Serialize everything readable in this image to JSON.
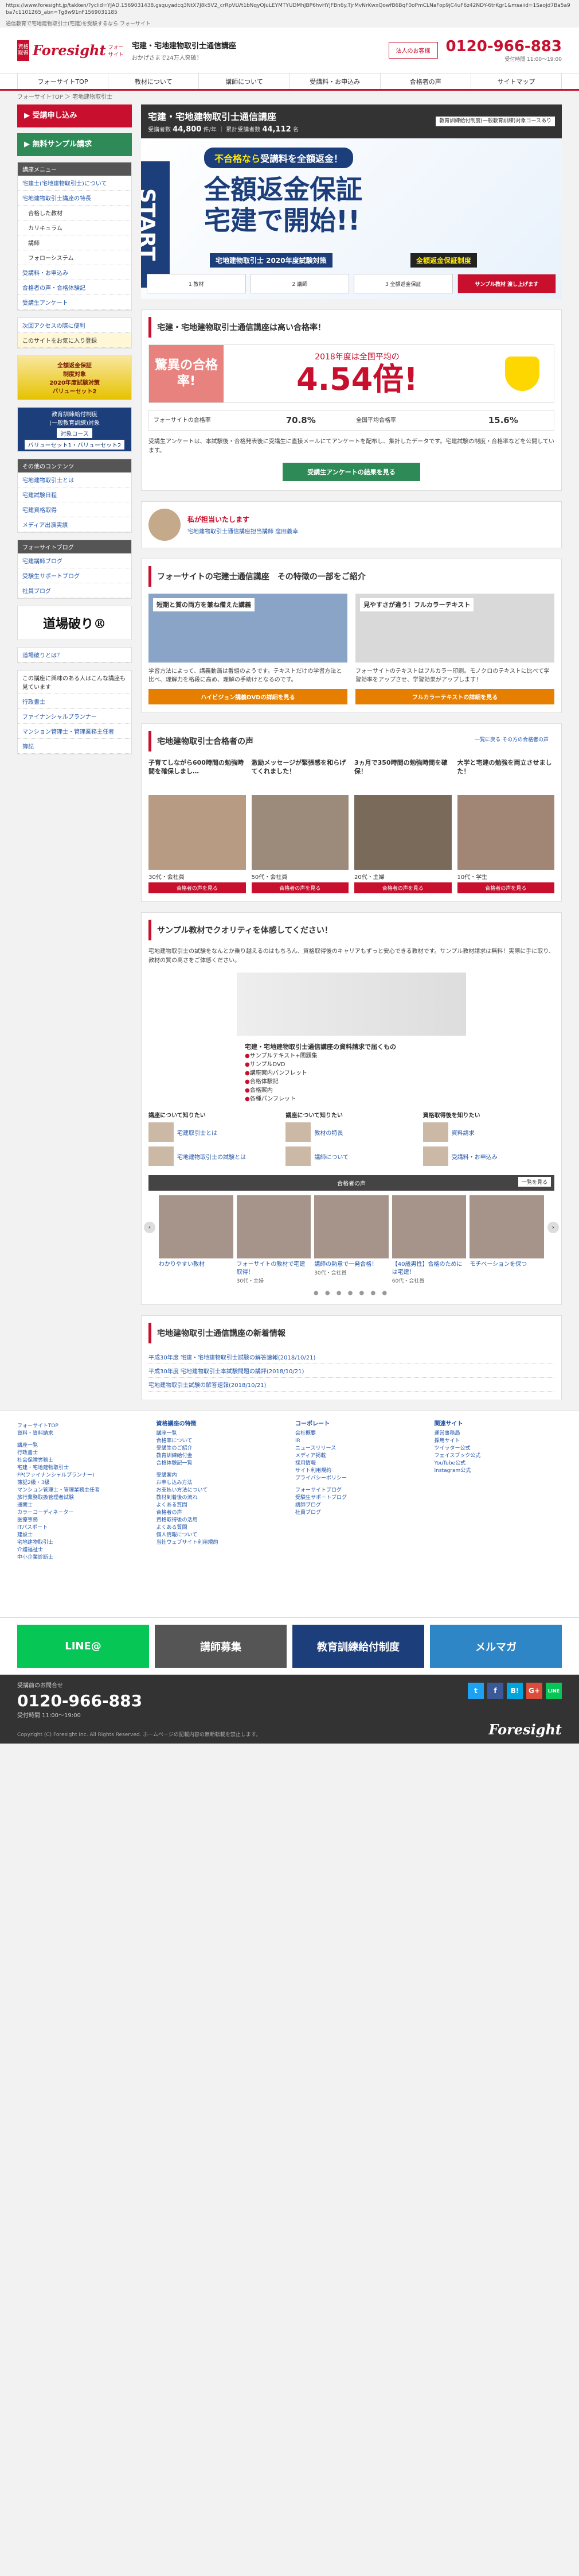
{
  "top": {
    "url": "https://www.foresight.jp/takken/?yclid=YJAD.1569031438.gsquyadcq3NtX7J8k5V2_crRpVLVt1bNqyOJuLEYMTYUDMhJBP6hvHYJFBn6y.TjrMvNrKwxQowfB6BqF0oPmCLNaFop9jC4uF6z42NDY-6trKgr1&msaiid=1SaoJd7Ba5a9ba7c1101265_abn=Tg8w91nF1569031185",
    "note": "通信教育で宅地建物取引士(宅建)を受験するなら フォーサイト"
  },
  "header": {
    "badge": "資格取得",
    "brand": "Foresight",
    "brand_sub": "フォーサイト",
    "title": "宅建・宅地建物取引士通信講座",
    "tagline": "おかげさまで24万人突破！",
    "corp_button": "法人のお客様",
    "tel": "0120-966-883",
    "tel_hours": "受付時間 11:00〜19:00"
  },
  "nav": [
    "フォーサイトTOP",
    "教材について",
    "講師について",
    "受講料・お申込み",
    "合格者の声",
    "サイトマップ"
  ],
  "breadcrumb": "フォーサイトTOP ＞ 宅地建物取引士",
  "sidebar": {
    "apply_button": "受講申し込み",
    "sample_button": "無料サンプル請求",
    "menu_title": "講座メニュー",
    "menu": [
      {
        "label": "宅建士(宅地建物取引士)について",
        "type": "main"
      },
      {
        "label": "宅地建物取引士講座の特長",
        "type": "main"
      },
      {
        "label": "合格した教材",
        "type": "sub"
      },
      {
        "label": "カリキュラム",
        "type": "sub"
      },
      {
        "label": "講師",
        "type": "sub"
      },
      {
        "label": "フォローシステム",
        "type": "sub"
      },
      {
        "label": "受講料・お申込み",
        "type": "main"
      },
      {
        "label": "合格者の声・合格体験記",
        "type": "main"
      },
      {
        "label": "受講生アンケート",
        "type": "main"
      }
    ],
    "guide_title": "次回アクセスの際に便利",
    "guide_item": "このサイトをお気に入り登録",
    "banner1": {
      "l1": "全額返金保証",
      "l2": "制度対象",
      "l3": "2020年度試験対策",
      "l4": "バリューセット2"
    },
    "banner2": {
      "l1": "教育訓練給付制度",
      "l2": "(一般教育訓練)対象",
      "l3": "対象コース",
      "l4": "バリューセット1・バリューセット2"
    },
    "other_title": "その他のコンテンツ",
    "other": [
      "宅地建物取引士とは",
      "宅建試験日程",
      "宅建資格取得",
      "メディア出演実績"
    ],
    "blog_title": "フォーサイトブログ",
    "blog": [
      "宅建講師ブログ",
      "受験生サポートブログ",
      "社員ブログ"
    ],
    "dojo": "道場破り®",
    "dojo_link": "道場破りとは？",
    "interest_title": "この講座に興味のある人はこんな講座も見ています",
    "interest": [
      "行政書士",
      "ファイナンシャルプランナー",
      "マンション管理士・管理業務主任者",
      "簿記"
    ]
  },
  "hero": {
    "title": "宅建・宅地建物取引士通信講座",
    "stats_label1": "受講者数",
    "stats_value1": "44,800",
    "stats_unit1": "件/年",
    "stats_label2": "累計受講者数",
    "stats_value2": "44,112",
    "stats_unit2": "名",
    "date_box": "教育訓練給付制度(一般教育訓練)対象コースあり",
    "start": "START",
    "ribbon_pre": "不合格なら",
    "ribbon_main": "受講料を全額返金！",
    "headline1": "全額返金保証",
    "headline2": "宅建で開始!!",
    "label1": "宅地建物取引士 2020年度試験対策",
    "label2": "全額返金保証制度",
    "thumbs": [
      "1 教材",
      "2 講師",
      "3 全額返金保証",
      "サンプル教材 渡し上げます"
    ]
  },
  "pass": {
    "title": "宅建・宅地建物取引士通信講座は高い合格率！",
    "left": "驚異の合格率!",
    "sub": "2018年度は全国平均の",
    "big": "4.54倍!",
    "fs_label": "フォーサイトの合格率",
    "fs_value": "70.8%",
    "nat_label": "全国平均合格率",
    "nat_value": "15.6%",
    "note": "受講生アンケートは、本試験後・合格発表後に受講生に直接メールにてアンケートを配布し、集計したデータです。宅建試験の制度・合格率などを公開しています。",
    "button": "受講生アンケートの結果を見る"
  },
  "teacher": {
    "title": "私が担当いたします",
    "name": "宅地建物取引士通信講座担当講師 窪田義幸"
  },
  "features": {
    "title": "フォーサイトの宅建士通信講座　その特徴の一部をご紹介",
    "cards": [
      {
        "cap": "短期と質の両方を兼ね備えた講義",
        "text": "学習方法によって、講義動画は番組のようです。テキストだけの学習方法と比べ、理解力を格段に高め、理解の手助けとなるのです。",
        "btn": "ハイビジョン講義DVDの詳細を見る"
      },
      {
        "cap": "見やすさが違う！フルカラーテキスト",
        "text": "フォーサイトのテキストはフルカラー印刷。モノクロのテキストに比べて学習効率をアップさせ、学習効果がアップします！",
        "btn": "フルカラーテキストの詳細を見る"
      }
    ]
  },
  "voices": {
    "title": "宅地建物取引士合格者の声",
    "link": "一覧に戻る その方の合格者の声",
    "items": [
      {
        "quote": "子育てしながら600時間の勉強時間を確保しまし…",
        "name": "30代・会社員",
        "btn": "合格者の声を見る"
      },
      {
        "quote": "激励メッセージが緊張感を和らげてくれました！",
        "name": "50代・会社員",
        "btn": "合格者の声を見る"
      },
      {
        "quote": "3ヵ月で350時間の勉強時間を確保！",
        "name": "20代・主婦",
        "btn": "合格者の声を見る"
      },
      {
        "quote": "大学と宅建の勉強を両立させました！",
        "name": "10代・学生",
        "btn": "合格者の声を見る"
      }
    ]
  },
  "sample": {
    "title": "サンプル教材でクオリティを体感してください！",
    "text": "宅地建物取引士の試験をなんとか乗り越えるのはもちろん、資格取得後のキャリアもずっと安心できる教材です。サンプル教材請求は無料！実際に手に取り、教材の質の高さをご体感ください。",
    "list_title": "宅建・宅地建物取引士通信講座の資料請求で届くもの",
    "list": [
      "サンプルテキスト+問題集",
      "サンプルDVD",
      "講座案内パンフレット",
      "合格体験記",
      "合格案内",
      "各種パンフレット"
    ]
  },
  "categories": [
    {
      "h": "講座について知りたい",
      "items": [
        "宅建取引士とは",
        "宅地建物取引士の試験とは"
      ]
    },
    {
      "h": "講座について知りたい",
      "items": [
        "教材の特長",
        "講師について"
      ]
    },
    {
      "h": "資格取得後を知りたい",
      "items": [
        "資料請求",
        "受講料・お申込み"
      ]
    }
  ],
  "carousel": {
    "title": "合格者の声",
    "all": "一覧を見る",
    "items": [
      {
        "t": "わかりやすい教材",
        "s": ""
      },
      {
        "t": "フォーサイトの教材で宅建取得！",
        "s": "30代・主婦"
      },
      {
        "t": "講師の熱意で一発合格！",
        "s": "30代・会社員"
      },
      {
        "t": "【40歳男性】合格のためには宅建！",
        "s": "60代・会社員"
      },
      {
        "t": "モチベーションを保つ",
        "s": ""
      }
    ],
    "dots": "● ● ● ● ● ● ●"
  },
  "news": {
    "title": "宅地建物取引士通信講座の新着情報",
    "items": [
      "平成30年度 宅建・宅地建物取引士試験の解答速報(2018/10/21)",
      "平成30年度 宅地建物取引士本試験問題の講評(2018/10/21)",
      "宅地建物取引士試験の解答速報(2018/10/21)"
    ]
  },
  "footer": {
    "cols": [
      {
        "h": "",
        "items": [
          "フォーサイトTOP",
          "資料・資料請求",
          "",
          "講座一覧",
          "行政書士",
          "社会保険労務士",
          "宅建・宅地建物取引士",
          "FP(ファイナンシャルプランナー)",
          "簿記2級・3級",
          "マンション管理士・管理業務主任者",
          "旅行業務取扱管理者試験",
          "通関士",
          "カラーコーディネーター",
          "医療事務",
          "ITパスポート",
          "建設士",
          "宅地建物取引士",
          "介護福祉士",
          "中小企業診断士"
        ]
      },
      {
        "h": "資格講座の特徴",
        "items": [
          "講座一覧",
          "合格率について",
          "受講生のご紹介",
          "教育訓練給付金",
          "合格体験記一覧",
          "",
          "受講案内",
          "お申し込み方法",
          "お支払い方法について",
          "教材到着後の流れ",
          "よくある質問",
          "合格者の声",
          "資格取得後の活用",
          "よくある質問",
          "個人情報について",
          "当社ウェブサイト利用規約"
        ]
      },
      {
        "h": "コーポレート",
        "items": [
          "会社概要",
          "IR",
          "ニュースリリース",
          "メディア掲載",
          "採用情報",
          "サイト利用規約",
          "プライバシーポリシー",
          "",
          "フォーサイトブログ",
          "受験生サポートブログ",
          "講師ブログ",
          "社員ブログ"
        ]
      },
      {
        "h": "関連サイト",
        "items": [
          "運営事務局",
          "採用サイト",
          "ツイッター公式",
          "フェイスブック公式",
          "YouTube公式",
          "Instagram公式"
        ]
      }
    ]
  },
  "promo": {
    "line": "LINE@",
    "recruit": "講師募集",
    "edu": "教育訓練給付制度",
    "mag": "メルマガ"
  },
  "bottom": {
    "h": "受講前のお問合せ",
    "tel": "0120-966-883",
    "hours": "受付時間 11:00〜19:00",
    "copy": "Copyright (C) Foresight Inc. All Rights Reserved. ホームページの記載内容の無断転載を禁止します。",
    "logo": "Foresight"
  },
  "social": [
    "t",
    "f",
    "B!",
    "G+",
    "LINE"
  ],
  "colors": {
    "brand_red": "#c8102e",
    "navy": "#1c3e7a",
    "green": "#2e8b57",
    "orange": "#e67e00"
  }
}
